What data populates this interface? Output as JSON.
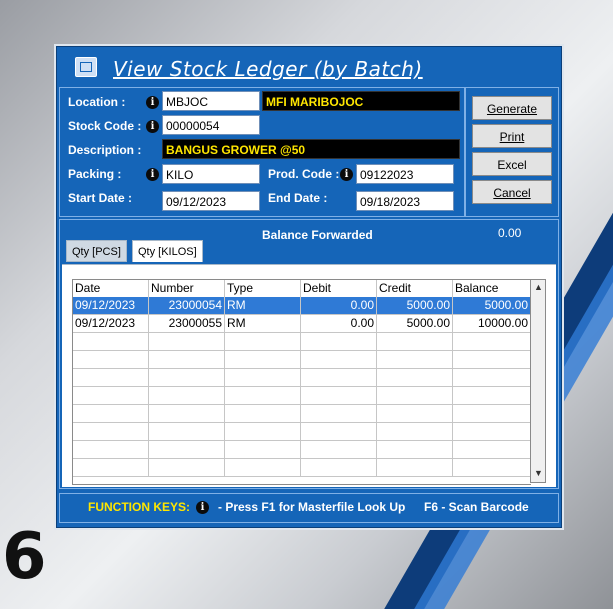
{
  "background": {
    "slide_number": "6"
  },
  "window": {
    "title": "View Stock Ledger (by Batch)",
    "accent": "#1565b8",
    "highlight": "#ffe600"
  },
  "form": {
    "location_label": "Location :",
    "location_code": "MBJOC",
    "location_name": "MFI MARIBOJOC",
    "stock_code_label": "Stock Code :",
    "stock_code": "00000054",
    "description_label": "Description :",
    "description": "BANGUS GROWER @50",
    "packing_label": "Packing :",
    "packing": "KILO",
    "prod_code_label": "Prod. Code :",
    "prod_code": "09122023",
    "start_date_label": "Start Date :",
    "start_date": "09/12/2023",
    "end_date_label": "End Date :",
    "end_date": "09/18/2023"
  },
  "buttons": {
    "generate": "Generate",
    "print": "Print",
    "excel": "Excel",
    "cancel": "Cancel"
  },
  "tabs": [
    {
      "label": "Qty [PCS]",
      "active": false
    },
    {
      "label": "Qty [KILOS]",
      "active": true
    }
  ],
  "balance_forwarded": {
    "label": "Balance Forwarded",
    "value": "0.00"
  },
  "ledger": {
    "columns": [
      "Date",
      "Number",
      "Type",
      "Debit",
      "Credit",
      "Balance"
    ],
    "rows": [
      {
        "date": "09/12/2023",
        "number": "23000054",
        "type": "RM",
        "debit": "0.00",
        "credit": "5000.00",
        "balance": "5000.00",
        "selected": true
      },
      {
        "date": "09/12/2023",
        "number": "23000055",
        "type": "RM",
        "debit": "0.00",
        "credit": "5000.00",
        "balance": "10000.00",
        "selected": false
      }
    ]
  },
  "footer": {
    "title": "FUNCTION KEYS:",
    "f1_text": "- Press F1 for Masterfile Look Up",
    "f6_text": "F6 - Scan Barcode"
  },
  "icons": {
    "info": "info-icon",
    "window": "ledger-window-icon"
  }
}
